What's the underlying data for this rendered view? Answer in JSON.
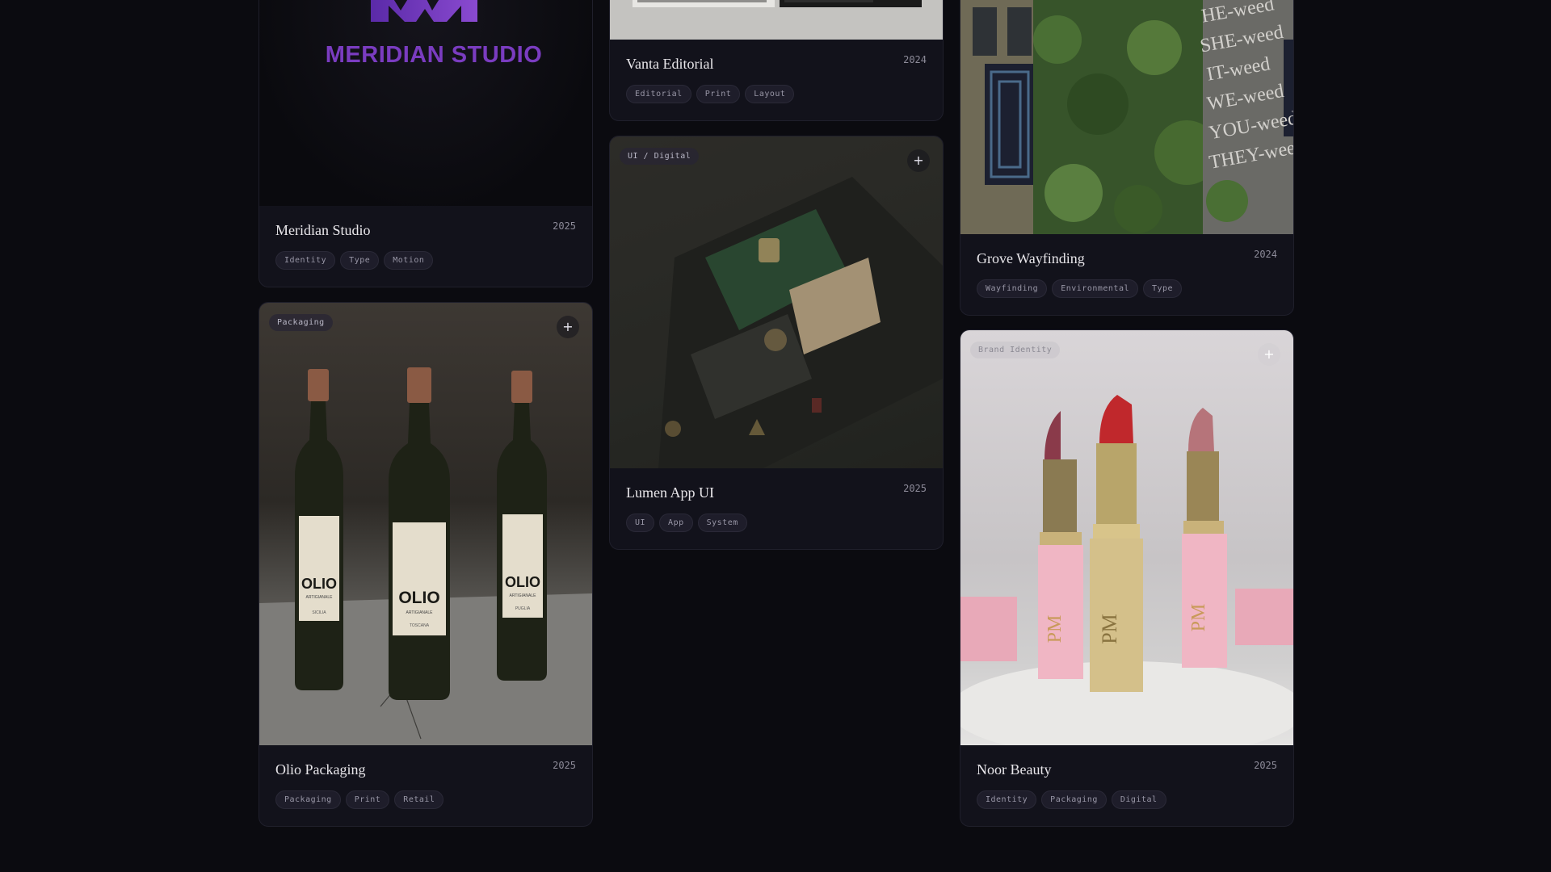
{
  "projects": [
    {
      "title": "Meridian Studio",
      "year": "2025",
      "tags": [
        "Identity",
        "Type",
        "Motion"
      ],
      "logo_text": "MERIDIAN STUDIO"
    },
    {
      "title": "Olio Packaging",
      "year": "2025",
      "category": "Packaging",
      "tags": [
        "Packaging",
        "Print",
        "Retail"
      ],
      "bottle_text": "OLIO",
      "bottle_sub": "ARTIGIANALE",
      "bottle_regions": [
        "SICILIA",
        "TOSCANA",
        "PUGLIA"
      ]
    },
    {
      "title": "Vanta Editorial",
      "year": "2024",
      "tags": [
        "Editorial",
        "Print",
        "Layout"
      ]
    },
    {
      "title": "Lumen App UI",
      "year": "2025",
      "category": "UI / Digital",
      "tags": [
        "UI",
        "App",
        "System"
      ]
    },
    {
      "title": "Grove Wayfinding",
      "year": "2024",
      "tags": [
        "Wayfinding",
        "Environmental",
        "Type"
      ],
      "wall_text": [
        "HE-weed",
        "SHE-weed",
        "IT-weed",
        "WE-weed",
        "YOU-weed",
        "THEY-weed"
      ]
    },
    {
      "title": "Noor Beauty",
      "year": "2025",
      "category": "Brand Identity",
      "tags": [
        "Identity",
        "Packaging",
        "Digital"
      ],
      "box_text": "PM"
    }
  ],
  "plus_symbol": "+"
}
